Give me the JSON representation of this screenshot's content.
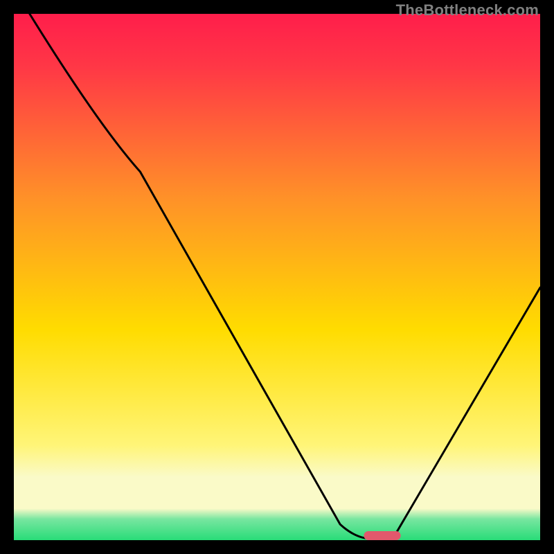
{
  "watermark": "TheBottleneck.com",
  "chart_data": {
    "type": "line",
    "title": "",
    "xlabel": "",
    "ylabel": "",
    "xlim": [
      0,
      100
    ],
    "ylim": [
      0,
      100
    ],
    "grid": false,
    "series": [
      {
        "name": "bottleneck-curve",
        "x": [
          3,
          16,
          24,
          62,
          68,
          72,
          100
        ],
        "y": [
          100,
          79,
          70,
          3,
          0,
          0,
          48
        ]
      }
    ],
    "marker": {
      "name": "optimal-marker",
      "shape": "rounded-bar",
      "color": "#e2586c",
      "x_center": 70,
      "x_width": 7,
      "y": 0
    },
    "background_gradient": {
      "top_rgb": [
        255,
        30,
        75
      ],
      "mid_rgb": [
        255,
        220,
        0
      ],
      "cream_rgb": [
        250,
        250,
        200
      ],
      "bottom_rgb": [
        40,
        220,
        120
      ]
    }
  }
}
